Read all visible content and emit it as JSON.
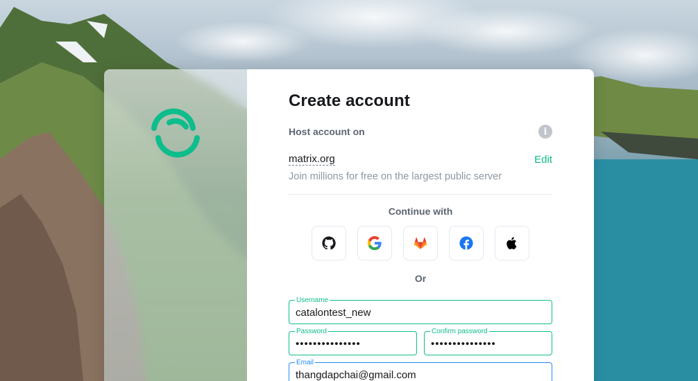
{
  "title": "Create account",
  "host": {
    "label": "Host account on",
    "info_icon": "info-icon",
    "server": "matrix.org",
    "edit_label": "Edit",
    "description": "Join millions for free on the largest public server"
  },
  "sso": {
    "label": "Continue with",
    "providers": [
      "github-icon",
      "google-icon",
      "gitlab-icon",
      "facebook-icon",
      "apple-icon"
    ]
  },
  "or_label": "Or",
  "form": {
    "username": {
      "label": "Username",
      "value": "catalontest_new"
    },
    "password": {
      "label": "Password",
      "value": "•••••••••••••••"
    },
    "confirm_password": {
      "label": "Confirm password",
      "value": "•••••••••••••••"
    },
    "email": {
      "label": "Email",
      "value": "thangdapchai@gmail.com"
    }
  },
  "colors": {
    "accent": "#0dbd8b",
    "focus": "#238cf5",
    "text": "#17191c",
    "muted": "#8d97a5"
  }
}
